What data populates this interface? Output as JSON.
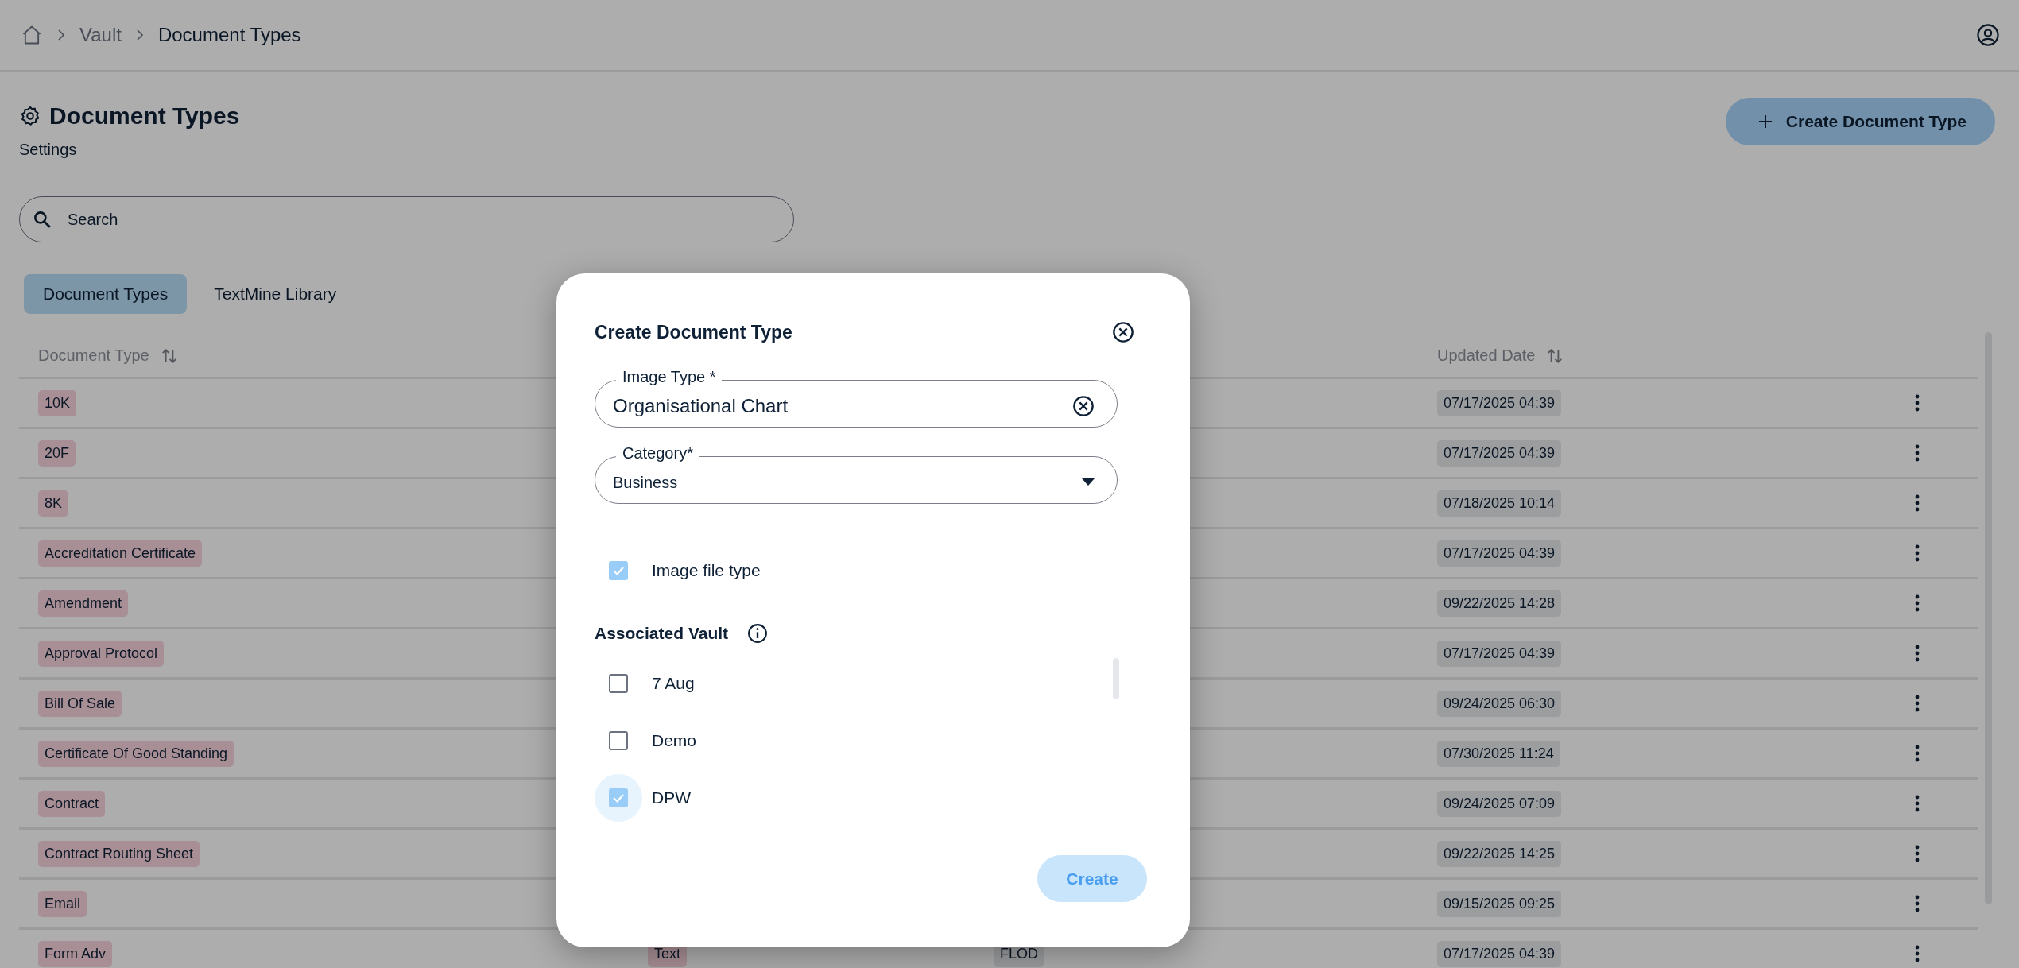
{
  "breadcrumb": [
    "Vault",
    "Document Types"
  ],
  "page": {
    "title": "Document Types",
    "subtitle": "Settings",
    "create_button": "Create Document Type"
  },
  "search": {
    "placeholder": "Search"
  },
  "tabs": [
    {
      "label": "Document Types",
      "selected": true
    },
    {
      "label": "TextMine Library",
      "selected": false
    }
  ],
  "table": {
    "columns": [
      "Document Type",
      "Updated Date"
    ],
    "rows": [
      {
        "type": "10K",
        "updated": "07/17/2025 04:39"
      },
      {
        "type": "20F",
        "updated": "07/17/2025 04:39"
      },
      {
        "type": "8K",
        "updated": "07/18/2025 10:14"
      },
      {
        "type": "Accreditation Certificate",
        "updated": "07/17/2025 04:39"
      },
      {
        "type": "Amendment",
        "updated": "09/22/2025 14:28"
      },
      {
        "type": "Approval Protocol",
        "updated": "07/17/2025 04:39"
      },
      {
        "type": "Bill Of Sale",
        "updated": "09/24/2025 06:30"
      },
      {
        "type": "Certificate Of Good Standing",
        "updated": "07/30/2025 11:24"
      },
      {
        "type": "Contract",
        "updated": "09/24/2025 07:09"
      },
      {
        "type": "Contract Routing Sheet",
        "updated": "09/22/2025 14:25"
      },
      {
        "type": "Email",
        "updated": "09/15/2025 09:25"
      },
      {
        "type": "Form Adv",
        "column_2": "Text",
        "column_3": "FLOD",
        "updated": "07/17/2025 04:39"
      }
    ]
  },
  "dialog": {
    "title": "Create Document Type",
    "image_type": {
      "label": "Image Type *",
      "value": "Organisational Chart"
    },
    "category": {
      "label": "Category*",
      "value": "Business"
    },
    "image_file_type": {
      "label": "Image file type",
      "checked": true
    },
    "vault_heading": "Associated Vault",
    "vaults": [
      {
        "label": "7 Aug",
        "checked": false,
        "focused": false
      },
      {
        "label": "Demo",
        "checked": false,
        "focused": false
      },
      {
        "label": "DPW",
        "checked": true,
        "focused": true
      }
    ],
    "create_button": "Create"
  }
}
